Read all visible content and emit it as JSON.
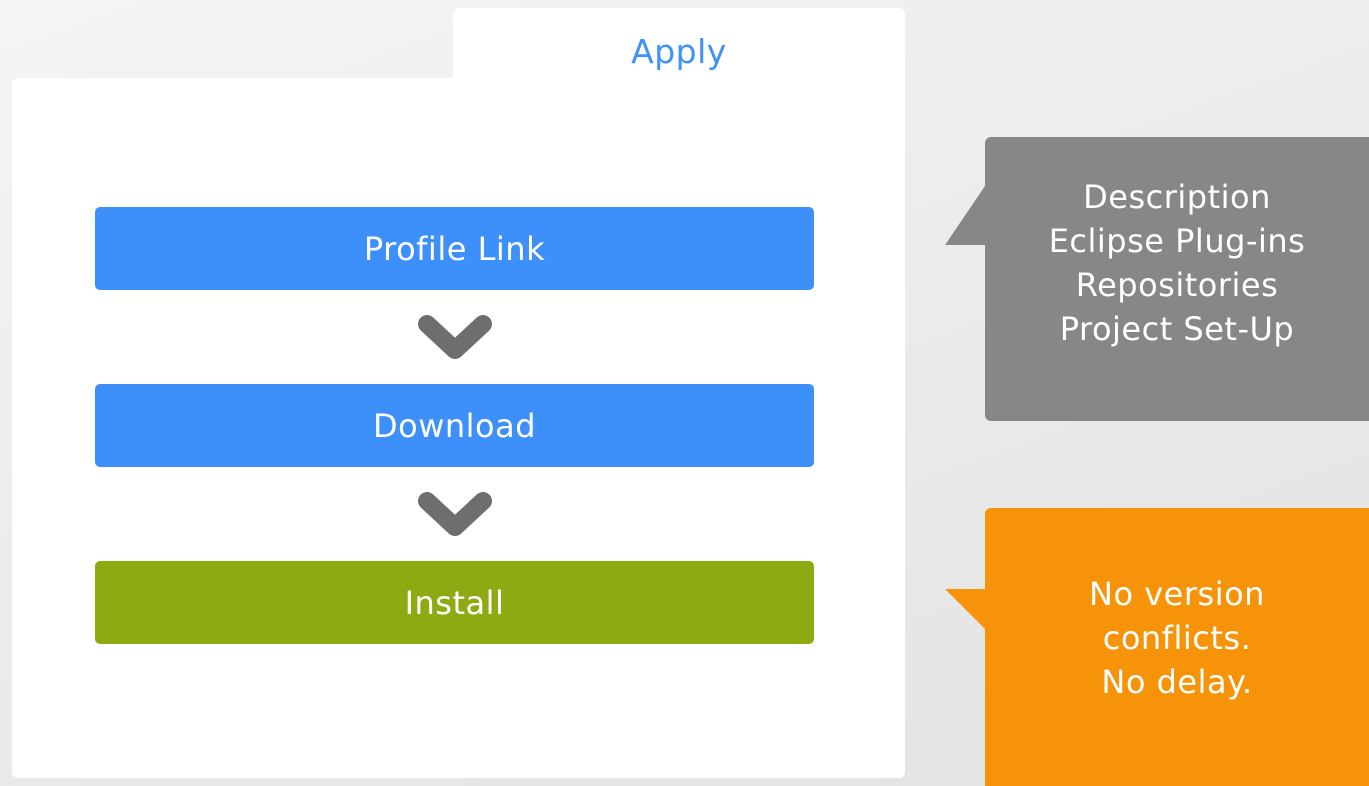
{
  "panel": {
    "tab_label": "Apply"
  },
  "steps": [
    {
      "label": "Profile Link"
    },
    {
      "label": "Download"
    },
    {
      "label": "Install"
    }
  ],
  "callouts": {
    "details": {
      "lines": [
        "Description",
        "Eclipse Plug-ins",
        "Repositories",
        "Project Set-Up"
      ],
      "color": "#878787"
    },
    "benefits": {
      "lines": [
        "No version",
        "conflicts.",
        "No delay."
      ],
      "color": "#f79309"
    }
  },
  "colors": {
    "accent_blue": "#3d8ff9",
    "install_green": "#8daa12",
    "chevron_gray": "#6e6e6e",
    "tab_text": "#3d93fb"
  },
  "icons": {
    "connector": "chevron-down-icon"
  }
}
